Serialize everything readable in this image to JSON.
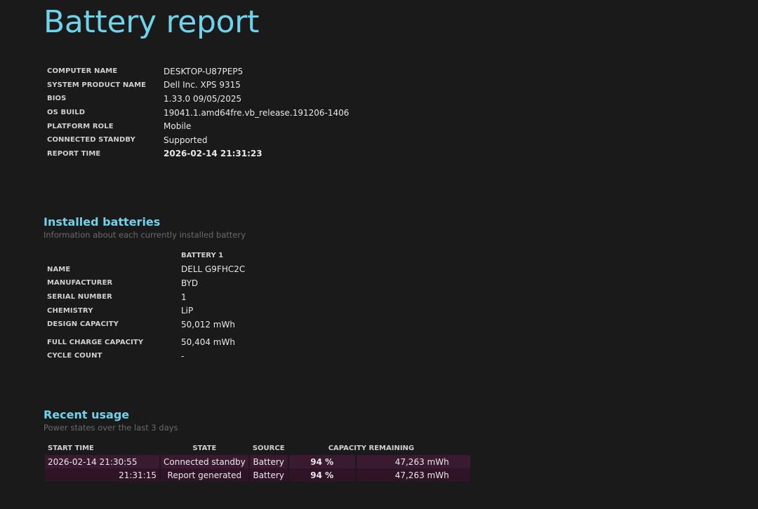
{
  "title": "Battery report",
  "system": [
    {
      "label": "COMPUTER NAME",
      "value": "DESKTOP-U87PEP5"
    },
    {
      "label": "SYSTEM PRODUCT NAME",
      "value": "Dell Inc. XPS 9315"
    },
    {
      "label": "BIOS",
      "value": "1.33.0 09/05/2025"
    },
    {
      "label": "OS BUILD",
      "value": "19041.1.amd64fre.vb_release.191206-1406"
    },
    {
      "label": "PLATFORM ROLE",
      "value": "Mobile"
    },
    {
      "label": "CONNECTED STANDBY",
      "value": "Supported"
    },
    {
      "label": "REPORT TIME",
      "value": "2026-02-14  21:31:23"
    }
  ],
  "installed_batteries": {
    "title": "Installed batteries",
    "subtitle": "Information about each currently installed battery",
    "column_header": "BATTERY 1",
    "rows": [
      {
        "label": "NAME",
        "value": "DELL G9FHC2C"
      },
      {
        "label": "MANUFACTURER",
        "value": "BYD"
      },
      {
        "label": "SERIAL NUMBER",
        "value": "1"
      },
      {
        "label": "CHEMISTRY",
        "value": "LiP"
      },
      {
        "label": "DESIGN CAPACITY",
        "value": "50,012 mWh"
      },
      {
        "label": "FULL CHARGE CAPACITY",
        "value": "50,404 mWh"
      },
      {
        "label": "CYCLE COUNT",
        "value": "-"
      }
    ]
  },
  "recent_usage": {
    "title": "Recent usage",
    "subtitle": "Power states over the last 3 days",
    "headers": {
      "start_time": "START TIME",
      "state": "STATE",
      "source": "SOURCE",
      "capacity_remaining": "CAPACITY REMAINING"
    },
    "rows": [
      {
        "start_time": "2026-02-14  21:30:55",
        "state": "Connected standby",
        "source": "Battery",
        "percent": "94 %",
        "mwh": "47,263 mWh"
      },
      {
        "start_time": "21:31:15",
        "state": "Report generated",
        "source": "Battery",
        "percent": "94 %",
        "mwh": "47,263 mWh"
      }
    ]
  }
}
